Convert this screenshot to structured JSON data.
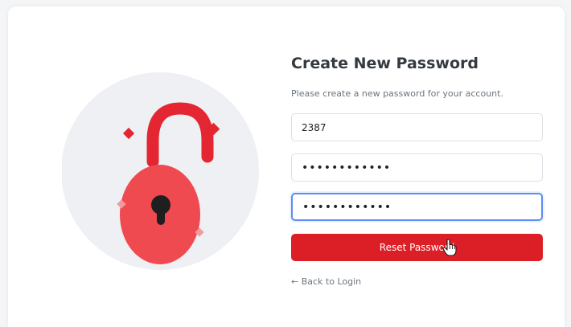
{
  "form": {
    "title": "Create New Password",
    "subtitle": "Please create a new password for your account.",
    "code_value": "2387",
    "new_password_value": "••••••••••••",
    "confirm_password_value": "••••••••••••",
    "submit_label": "Reset Password",
    "back_link_label": "← Back to Login"
  },
  "colors": {
    "accent": "#dc1f27",
    "focus": "#5b8ef0",
    "lock_body": "#ef4a4f",
    "lock_shackle": "#e32631",
    "illustration_bg": "#eef0f3"
  },
  "icons": {
    "illustration": "unlocked-padlock-icon",
    "cursor": "hand-pointer-icon"
  }
}
